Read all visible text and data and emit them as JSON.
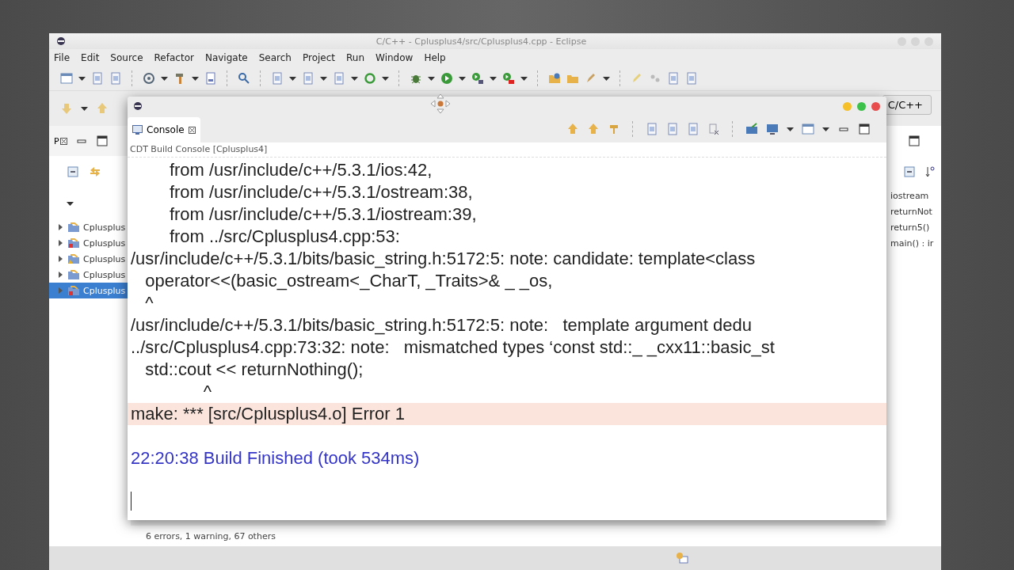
{
  "window": {
    "title": "C/C++ - Cplusplus4/src/Cplusplus4.cpp - Eclipse"
  },
  "menu": [
    "File",
    "Edit",
    "Source",
    "Refactor",
    "Navigate",
    "Search",
    "Project",
    "Run",
    "Window",
    "Help"
  ],
  "perspective": {
    "label": "C/C++"
  },
  "project_explorer": {
    "tab": "P",
    "items": [
      {
        "label": "Cplusplus",
        "kind": "folder",
        "selected": false
      },
      {
        "label": "Cplusplus",
        "kind": "error",
        "selected": false
      },
      {
        "label": "Cplusplus",
        "kind": "warning",
        "selected": false
      },
      {
        "label": "Cplusplus",
        "kind": "folder",
        "selected": false
      },
      {
        "label": "Cplusplus",
        "kind": "error",
        "selected": true
      }
    ]
  },
  "outline": {
    "items": [
      "iostream",
      "returnNot",
      "return5()",
      "main() : ir"
    ]
  },
  "problems": {
    "summary": "6 errors, 1 warning, 67 others"
  },
  "console": {
    "tab": "Console",
    "subtitle": "CDT Build Console [Cplusplus4]",
    "lines": [
      {
        "text": "        from /usr/include/c++/5.3.1/ios:42,",
        "kind": "text"
      },
      {
        "text": "        from /usr/include/c++/5.3.1/ostream:38,",
        "kind": "text"
      },
      {
        "text": "        from /usr/include/c++/5.3.1/iostream:39,",
        "kind": "text"
      },
      {
        "text": "        from ../src/Cplusplus4.cpp:53:",
        "kind": "text"
      },
      {
        "text": "/usr/include/c++/5.3.1/bits/basic_string.h:5172:5: note: candidate: template<class",
        "kind": "text"
      },
      {
        "text": "   operator<<(basic_ostream<_CharT, _Traits>& _ _os,",
        "kind": "text"
      },
      {
        "text": "   ^",
        "kind": "text"
      },
      {
        "text": "/usr/include/c++/5.3.1/bits/basic_string.h:5172:5: note:   template argument dedu",
        "kind": "text"
      },
      {
        "text": "../src/Cplusplus4.cpp:73:32: note:   mismatched types ‘const std::_ _cxx11::basic_st",
        "kind": "text"
      },
      {
        "text": "   std::cout << returnNothing();",
        "kind": "text"
      },
      {
        "text": "               ^",
        "kind": "text"
      },
      {
        "text": "make: *** [src/Cplusplus4.o] Error 1",
        "kind": "error"
      },
      {
        "kind": "blank"
      },
      {
        "text": "22:20:38 Build Finished (took 534ms)",
        "kind": "summary"
      }
    ]
  }
}
